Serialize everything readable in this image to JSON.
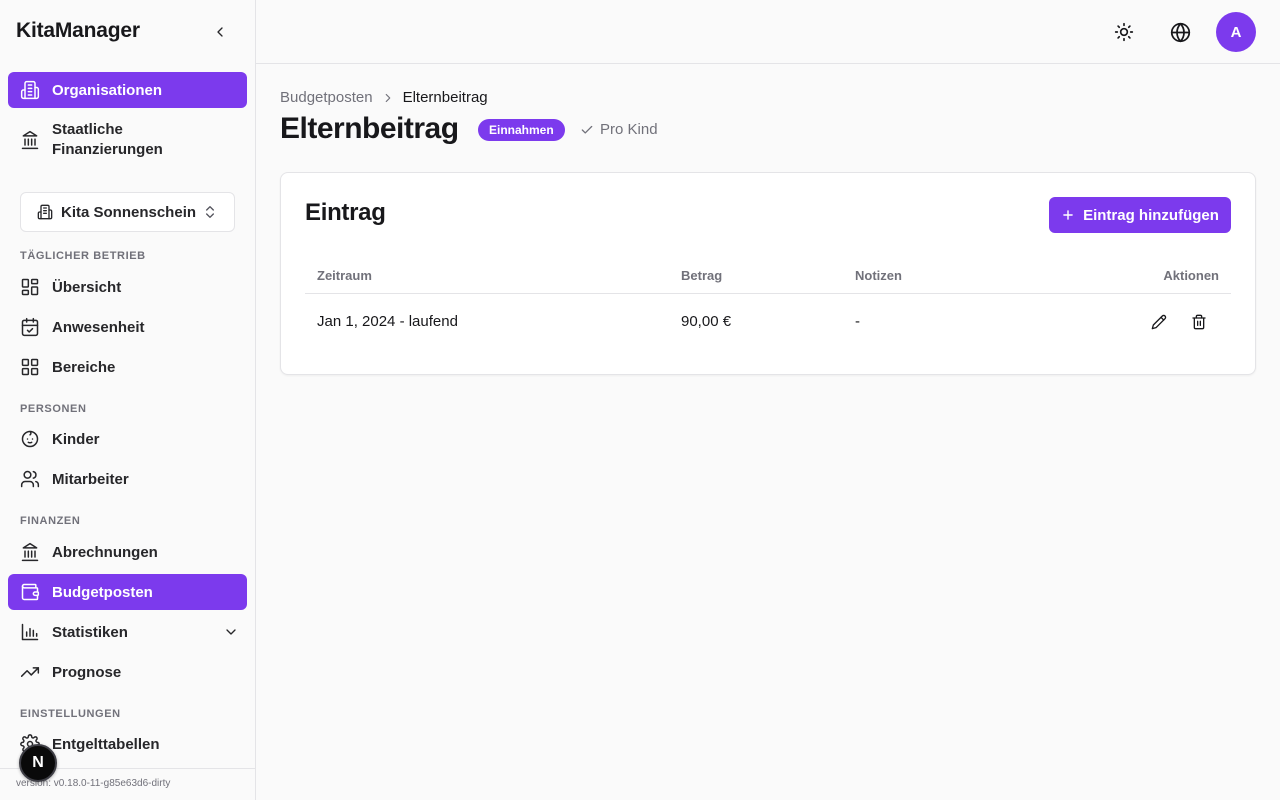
{
  "app": {
    "name": "KitaManager"
  },
  "sidebar": {
    "top_items": [
      {
        "label": "Organisationen",
        "icon": "building-icon",
        "active": true
      },
      {
        "label": "Staatliche Finanzierungen",
        "icon": "landmark-icon",
        "active": false
      }
    ],
    "organization_selector": {
      "value": "Kita Sonnenschein",
      "icon": "building-icon"
    },
    "sections": [
      {
        "label": "TÄGLICHER BETRIEB",
        "items": [
          {
            "label": "Übersicht",
            "icon": "layout-dashboard-icon"
          },
          {
            "label": "Anwesenheit",
            "icon": "calendar-check-icon"
          },
          {
            "label": "Bereiche",
            "icon": "grid-icon"
          }
        ]
      },
      {
        "label": "PERSONEN",
        "items": [
          {
            "label": "Kinder",
            "icon": "baby-icon"
          },
          {
            "label": "Mitarbeiter",
            "icon": "users-icon"
          }
        ]
      },
      {
        "label": "FINANZEN",
        "items": [
          {
            "label": "Abrechnungen",
            "icon": "landmark-icon"
          },
          {
            "label": "Budgetposten",
            "icon": "wallet-icon",
            "active": true
          },
          {
            "label": "Statistiken",
            "icon": "bar-chart-icon",
            "expandable": true
          },
          {
            "label": "Prognose",
            "icon": "trending-up-icon"
          }
        ]
      },
      {
        "label": "EINSTELLUNGEN",
        "items": [
          {
            "label": "Entgelttabellen",
            "icon": "settings-icon"
          }
        ]
      }
    ],
    "version": "version: v0.18.0-11-g85e63d6-dirty",
    "dev_badge": "N"
  },
  "header": {
    "theme_toggle_icon": "sun-icon",
    "language_icon": "globe-icon",
    "avatar_initial": "A"
  },
  "breadcrumb": {
    "parent": "Budgetposten",
    "current": "Elternbeitrag"
  },
  "page": {
    "title": "Elternbeitrag",
    "type_badge": "Einnahmen",
    "per_child_label": "Pro Kind"
  },
  "entries_card": {
    "title": "Eintrag",
    "add_button_label": "Eintrag hinzufügen",
    "columns": [
      "Zeitraum",
      "Betrag",
      "Notizen",
      "Aktionen"
    ],
    "rows": [
      {
        "period": "Jan 1, 2024 - laufend",
        "amount": "90,00 €",
        "notes": "-"
      }
    ]
  },
  "colors": {
    "accent": "#7c3aed",
    "text": "#18181b",
    "muted": "#71717a",
    "border": "#e4e4e7",
    "background": "#fafafa"
  }
}
